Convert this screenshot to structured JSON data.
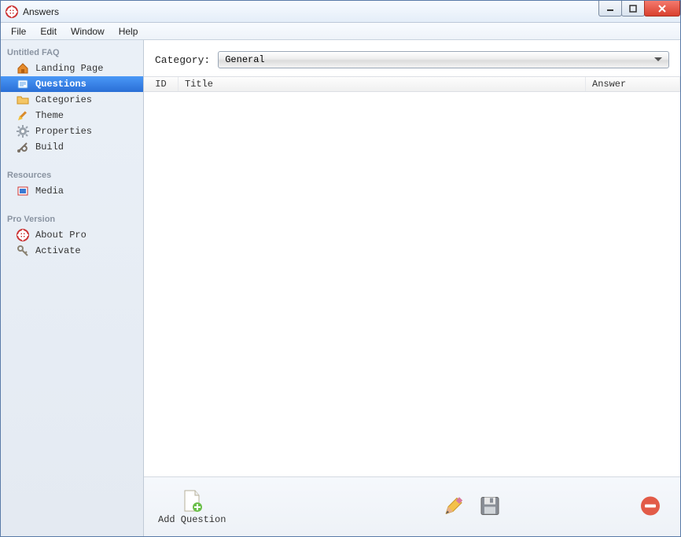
{
  "window": {
    "title": "Answers"
  },
  "menu": {
    "file": "File",
    "edit": "Edit",
    "window": "Window",
    "help": "Help"
  },
  "sidebar": {
    "group1": "Untitled FAQ",
    "items1": [
      {
        "label": "Landing Page"
      },
      {
        "label": "Questions"
      },
      {
        "label": "Categories"
      },
      {
        "label": "Theme"
      },
      {
        "label": "Properties"
      },
      {
        "label": "Build"
      }
    ],
    "group2": "Resources",
    "items2": [
      {
        "label": "Media"
      }
    ],
    "group3": "Pro Version",
    "items3": [
      {
        "label": "About Pro"
      },
      {
        "label": "Activate"
      }
    ]
  },
  "main": {
    "category_label": "Category:",
    "category_value": "General",
    "columns": {
      "id": "ID",
      "title": "Title",
      "answer": "Answer"
    }
  },
  "toolbar": {
    "add_question": "Add Question"
  }
}
